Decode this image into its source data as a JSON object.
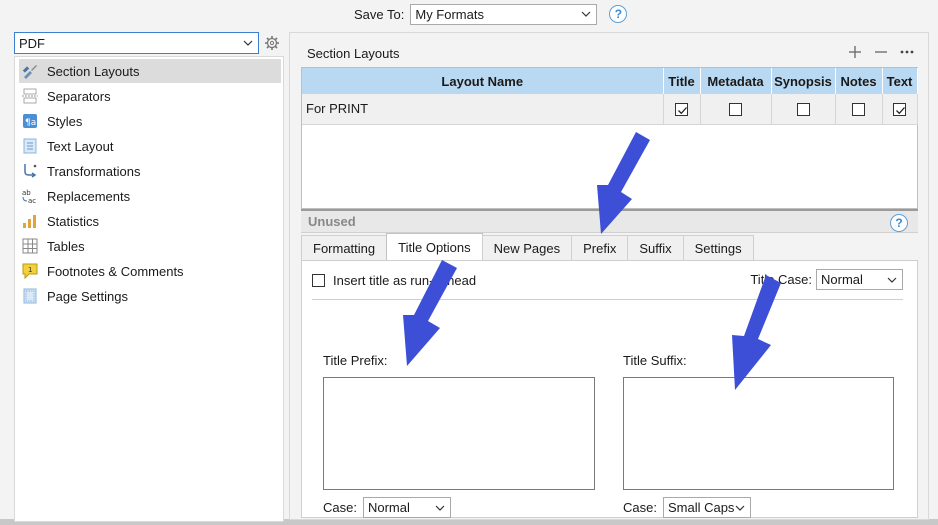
{
  "top": {
    "save_to_label": "Save To:",
    "save_to_value": "My Formats"
  },
  "left": {
    "format_select": "PDF",
    "nav": [
      {
        "label": "Section Layouts",
        "icon": "brush-icon",
        "selected": true
      },
      {
        "label": "Separators",
        "icon": "separators-icon",
        "selected": false
      },
      {
        "label": "Styles",
        "icon": "styles-icon",
        "selected": false
      },
      {
        "label": "Text Layout",
        "icon": "text-layout-icon",
        "selected": false
      },
      {
        "label": "Transformations",
        "icon": "transformations-icon",
        "selected": false
      },
      {
        "label": "Replacements",
        "icon": "replacements-icon",
        "selected": false
      },
      {
        "label": "Statistics",
        "icon": "statistics-icon",
        "selected": false
      },
      {
        "label": "Tables",
        "icon": "tables-icon",
        "selected": false
      },
      {
        "label": "Footnotes & Comments",
        "icon": "footnote-icon",
        "selected": false
      },
      {
        "label": "Page Settings",
        "icon": "page-settings-icon",
        "selected": false
      }
    ]
  },
  "section_layouts": {
    "title": "Section Layouts",
    "columns": [
      "Layout Name",
      "Title",
      "Metadata",
      "Synopsis",
      "Notes",
      "Text"
    ],
    "rows": [
      {
        "name": "For PRINT",
        "title": true,
        "metadata": false,
        "synopsis": false,
        "notes": false,
        "text": true
      }
    ],
    "unused_label": "Unused"
  },
  "tabs": [
    "Formatting",
    "Title Options",
    "New Pages",
    "Prefix",
    "Suffix",
    "Settings"
  ],
  "active_tab": "Title Options",
  "title_options": {
    "insert_label": "Insert title as run-in head",
    "title_case_label": "Title Case:",
    "title_case_value": "Normal",
    "prefix_label": "Title Prefix:",
    "suffix_label": "Title Suffix:",
    "prefix_case_label": "Case:",
    "prefix_case_value": "Normal",
    "suffix_case_label": "Case:",
    "suffix_case_value": "Small Caps"
  },
  "colors": {
    "header_blue": "#b9d8f2",
    "arrow_blue": "#3c4fd6",
    "help_blue": "#3b8bd0"
  }
}
